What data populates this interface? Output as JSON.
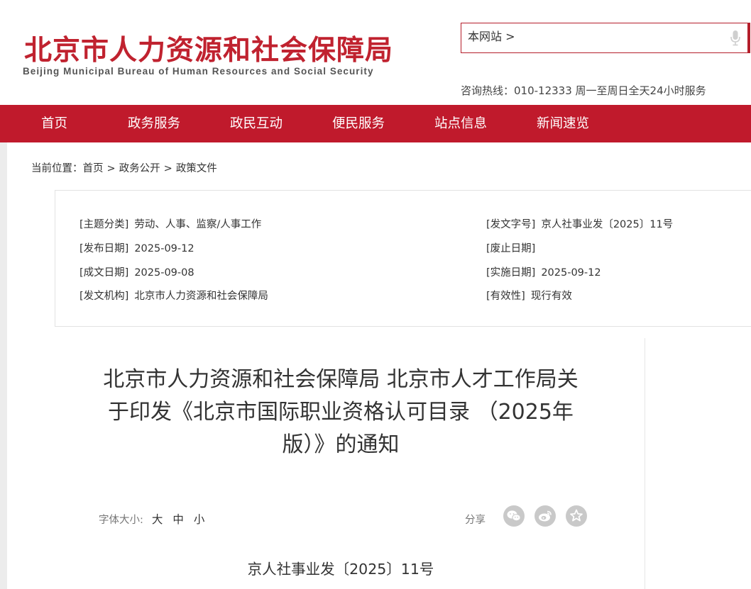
{
  "header": {
    "logo_cn": "北京市人力资源和社会保障局",
    "logo_en": "Beijing Municipal Bureau of Human Resources and Social Security",
    "search_value": "本网站 >",
    "hotline": "咨询热线：010-12333 周一至周日全天24小时服务"
  },
  "nav": {
    "items": [
      "首页",
      "政务服务",
      "政民互动",
      "便民服务",
      "站点信息",
      "新闻速览"
    ]
  },
  "breadcrumb": {
    "label": "当前位置：",
    "items": [
      "首页",
      "政务公开",
      "政策文件"
    ],
    "separator": ">"
  },
  "info": {
    "subject_key": "[主题分类]",
    "subject_val": "劳动、人事、监察/人事工作",
    "docno_key": "[发文字号]",
    "docno_val": "京人社事业发〔2025〕11号",
    "pubdate_key": "[发布日期]",
    "pubdate_val": "2025-09-12",
    "abolish_key": "[废止日期]",
    "abolish_val": "",
    "written_key": "[成文日期]",
    "written_val": "2025-09-08",
    "effective_key": "[实施日期]",
    "effective_val": "2025-09-12",
    "issuer_key": "[发文机构]",
    "issuer_val": "北京市人力资源和社会保障局",
    "validity_key": "[有效性]",
    "validity_val": "现行有效"
  },
  "article": {
    "title_line1": "北京市人力资源和社会保障局 北京市人才工作局关",
    "title_line2": "于印发《北京市国际职业资格认可目录 （2025年",
    "title_line3": "版）》的通知",
    "font_size_label": "字体大小:",
    "font_sizes": [
      "大",
      "中",
      "小"
    ],
    "share_label": "分享",
    "share_icons": [
      "wechat-icon",
      "weibo-icon",
      "favorite-star-icon"
    ],
    "doc_number": "京人社事业发〔2025〕11号"
  },
  "colors": {
    "brand_red": "#c01a2c",
    "logo_red": "#c0222f",
    "icon_grey": "#c9c9c9"
  }
}
